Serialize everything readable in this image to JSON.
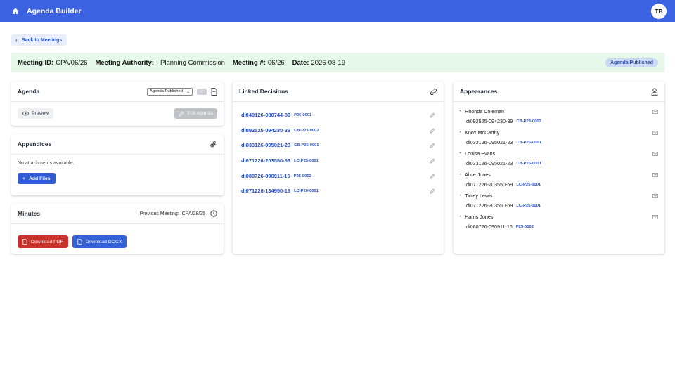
{
  "app": {
    "title": "Agenda Builder",
    "avatar_initials": "TB"
  },
  "nav": {
    "back_label": "Back to Meetings"
  },
  "meeting": {
    "id_label": "Meeting ID:",
    "id_value": "CPA/06/26",
    "authority_label": "Meeting Authority:",
    "authority_value": "Planning Commission",
    "number_label": "Meeting #:",
    "number_value": "06/26",
    "date_label": "Date:",
    "date_value": "2026-08-19",
    "status_badge": "Agenda Published"
  },
  "agenda": {
    "title": "Agenda",
    "status_select": "Agenda Published",
    "preview_label": "Preview",
    "edit_label": "Edit Agenda"
  },
  "appendices": {
    "title": "Appendices",
    "empty_text": "No attachments available.",
    "add_label": "Add Files"
  },
  "minutes": {
    "title": "Minutes",
    "previous_label": "Previous Meeting:",
    "previous_value": "CPA/28/25",
    "download_pdf": "Download PDF",
    "download_docx": "Download DOCX"
  },
  "linked_decisions": {
    "title": "Linked Decisions",
    "items": [
      {
        "id": "di040126-080744-80",
        "code": "P26-0001"
      },
      {
        "id": "di092525-094230-39",
        "code": "CB-P23-0002"
      },
      {
        "id": "di033126-095021-23",
        "code": "CB-P26-0001"
      },
      {
        "id": "di071226-203550-69",
        "code": "LC-P25-0001"
      },
      {
        "id": "di080726-090911-16",
        "code": "P25-0002"
      },
      {
        "id": "di071226-134950-19",
        "code": "LC-P26-0001"
      }
    ]
  },
  "appearances": {
    "title": "Appearances",
    "items": [
      {
        "name": "Rhonda Coleman",
        "decision": "di092525-094230-39",
        "code": "CB-P23-0002"
      },
      {
        "name": "Knox McCarthy",
        "decision": "di033126-095021-23",
        "code": "CB-P26-0001"
      },
      {
        "name": "Louisa Evans",
        "decision": "di033126-095021-23",
        "code": "CB-P26-0001"
      },
      {
        "name": "Alice Jones",
        "decision": "di071226-203550-69",
        "code": "LC-P25-0001"
      },
      {
        "name": "Tinley Lewis",
        "decision": "di071226-203550-69",
        "code": "LC-P25-0001"
      },
      {
        "name": "Harris Jones",
        "decision": "di080726-090911-16",
        "code": "P25-0002"
      }
    ]
  },
  "colors": {
    "primary": "#3b62e0",
    "success_bg": "#e6f8ea",
    "danger": "#c9312b",
    "link": "#2a50c8"
  }
}
